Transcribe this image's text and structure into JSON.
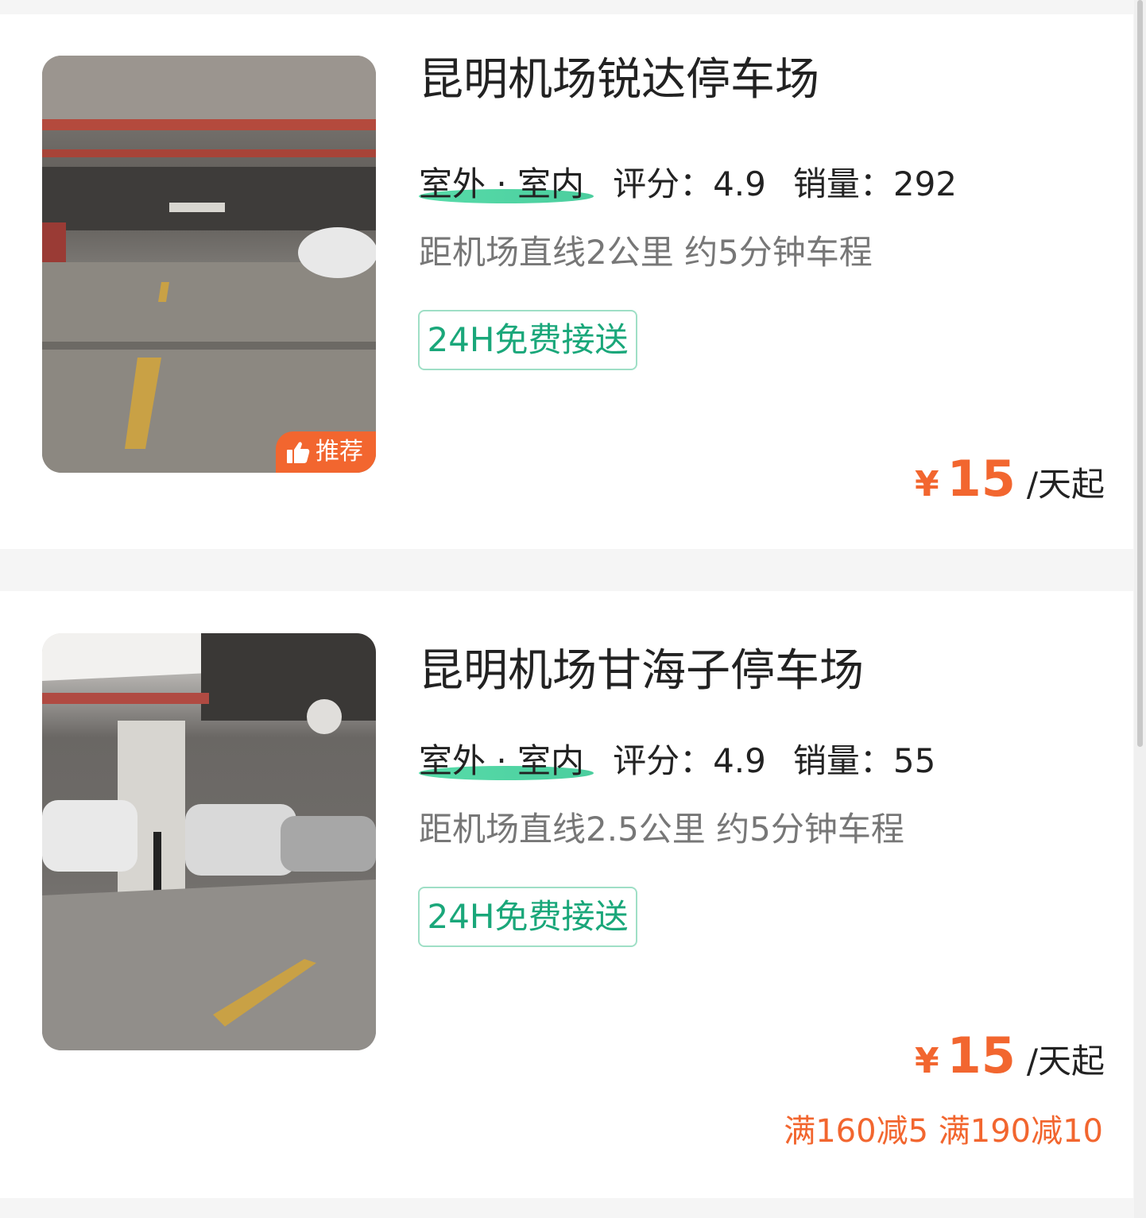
{
  "listings": [
    {
      "name": "昆明机场锐达停车场",
      "environment": "室外 · 室内",
      "rating_label": "评分：4.9",
      "sales_label": "销量：292",
      "distance": "距机场直线2公里 约5分钟车程",
      "tag": "24H免费接送",
      "currency": "¥",
      "price": "15",
      "price_unit": "/天起",
      "badge": "推荐",
      "discount": ""
    },
    {
      "name": "昆明机场甘海子停车场",
      "environment": "室外 · 室内",
      "rating_label": "评分：4.9",
      "sales_label": "销量：55",
      "distance": "距机场直线2.5公里 约5分钟车程",
      "tag": "24H免费接送",
      "currency": "¥",
      "price": "15",
      "price_unit": "/天起",
      "badge": "",
      "discount": "满160减5 满190减10"
    }
  ],
  "colors": {
    "accent_orange": "#f2662f",
    "tag_green": "#1aa77a",
    "highlight_green": "#3ad59a"
  },
  "icons": {
    "badge_icon": "thumbs-up-icon"
  }
}
